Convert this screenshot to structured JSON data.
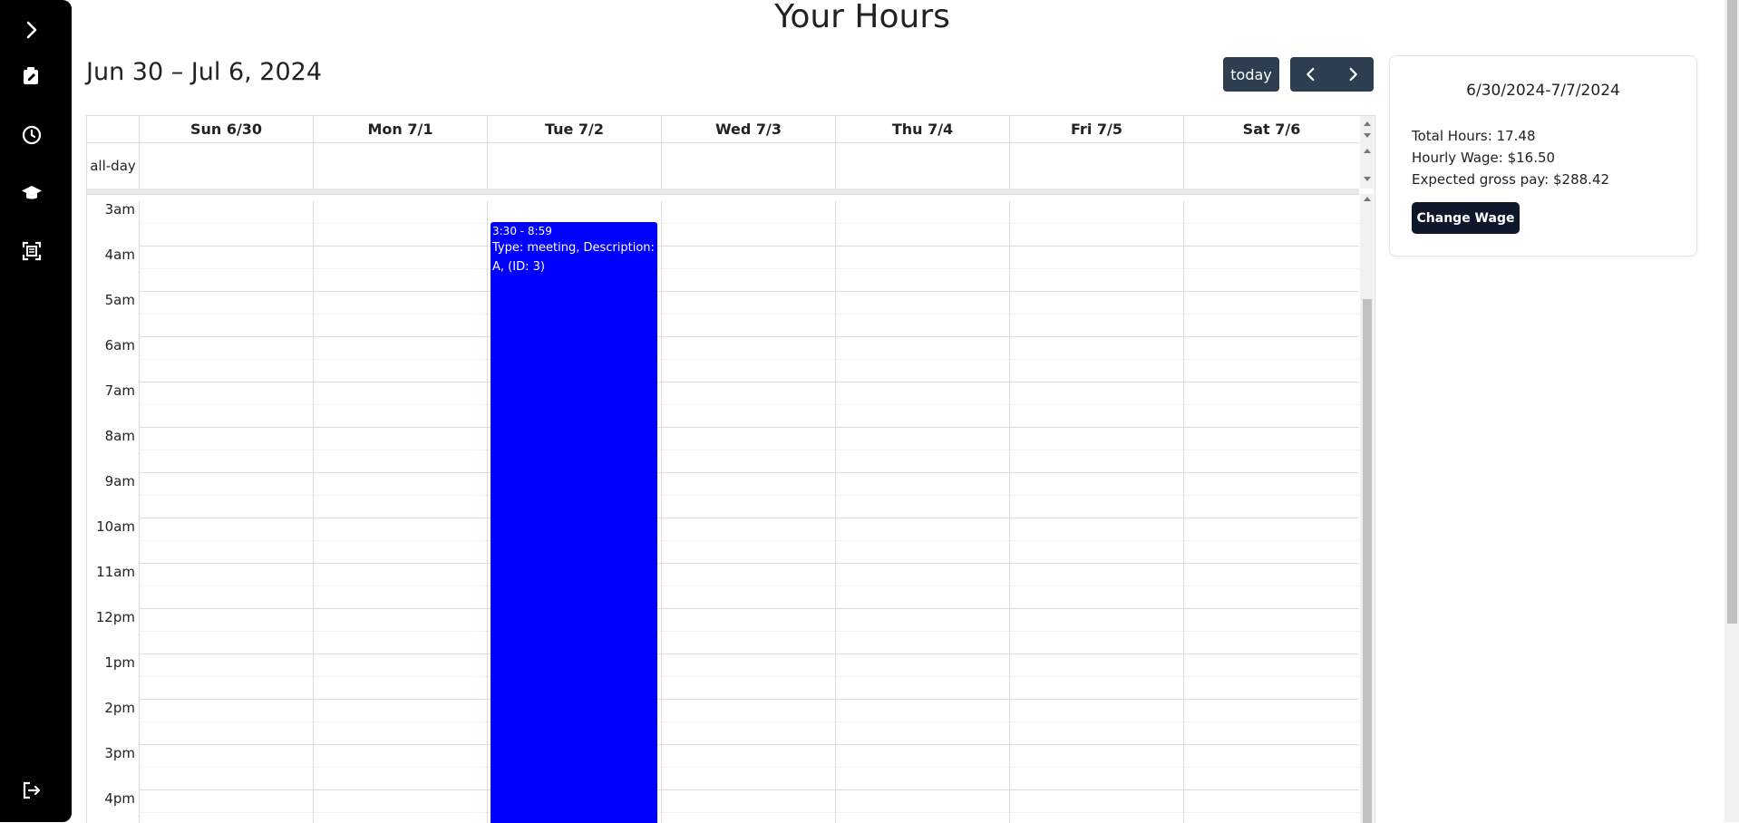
{
  "sidebar": {
    "items": [
      {
        "icon": "chevron-right-icon"
      },
      {
        "icon": "edit-icon"
      },
      {
        "icon": "clock-icon"
      },
      {
        "icon": "graduation-cap-icon"
      },
      {
        "icon": "scan-icon"
      },
      {
        "icon": "logout-icon"
      }
    ]
  },
  "page": {
    "title": "Your Hours"
  },
  "toolbar": {
    "range": "Jun 30 – Jul 6, 2024",
    "today_label": "today",
    "prev_icon": "chevron-left-icon",
    "next_icon": "chevron-right-icon"
  },
  "calendar": {
    "days": [
      "Sun 6/30",
      "Mon 7/1",
      "Tue 7/2",
      "Wed 7/3",
      "Thu 7/4",
      "Fri 7/5",
      "Sat 7/6"
    ],
    "allday_label": "all-day",
    "times": [
      "3am",
      "4am",
      "5am",
      "6am",
      "7am",
      "8am",
      "9am",
      "10am",
      "11am",
      "12pm",
      "1pm",
      "2pm",
      "3pm",
      "4pm"
    ],
    "event": {
      "time": "3:30 - 8:59",
      "desc": "Type: meeting, Description: A, (ID: 3)",
      "color": "#0000ff"
    }
  },
  "summary": {
    "range": "6/30/2024-7/7/2024",
    "total_hours": "Total Hours: 17.48",
    "hourly_wage": "Hourly Wage: $16.50",
    "gross_pay": "Expected gross pay: $288.42",
    "change_wage_label": "Change Wage"
  },
  "colors": {
    "sidebar_bg": "#000000",
    "button_bg": "#2c3e50",
    "change_wage_bg": "#0f172a",
    "event_bg": "#0000ff"
  }
}
